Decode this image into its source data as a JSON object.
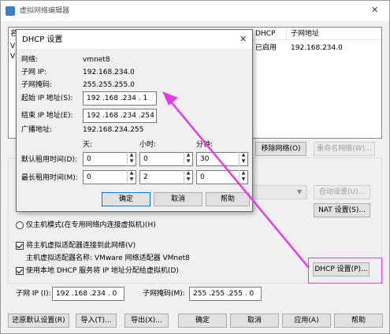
{
  "main_window": {
    "title": "虚拟网络编辑器",
    "close_glyph": "✕",
    "table": {
      "headers": [
        "名",
        "DHCP",
        "子网地址"
      ],
      "rows": [
        {
          "name": "V",
          "dhcp": "",
          "subnet": ""
        },
        {
          "name": "V",
          "dhcp": "已启用",
          "subnet": "192.168.234.0"
        }
      ]
    },
    "buttons": {
      "remove_network": "移除网络(O)",
      "rename_network": "重命名网络(W)...",
      "auto_settings": "自动设置(U)...",
      "nat_settings": "NAT 设置(S)...",
      "dhcp_settings": "DHCP 设置(P)...",
      "restore_defaults": "还原默认设置(R)",
      "import": "导入(T)...",
      "export": "导出(X)...",
      "ok": "确定",
      "cancel": "取消",
      "apply": "应用(A)",
      "help": "帮助"
    },
    "host_only_label": "仅主机模式(在专用网络内连接虚拟机)(H)",
    "connect_adapter_label": "将主机虚拟适配器连接到此网络(V)",
    "adapter_name_label": "主机虚拟适配器名称: VMware 网络适配器 VMnet8",
    "use_dhcp_label": "使用本地 DHCP 服务将 IP 地址分配给虚拟机(D)",
    "subnet_ip_label": "子网 IP (I):",
    "subnet_ip_value": "192 .168 .234 . 0",
    "subnet_mask_label": "子网掩码(M):",
    "subnet_mask_value": "255 .255 .255 . 0"
  },
  "dhcp_dialog": {
    "title": "DHCP 设置",
    "close_glyph": "✕",
    "network_label": "网络:",
    "network_value": "vmnet8",
    "subnet_ip_label": "子网 IP:",
    "subnet_ip_value": "192.168.234.0",
    "subnet_mask_label": "子网掩码:",
    "subnet_mask_value": "255.255.255.0",
    "start_ip_label": "起始 IP 地址(S):",
    "start_ip_value": "192 .168 .234 . 1",
    "end_ip_label": "结束 IP 地址(E):",
    "end_ip_value": "192 .168 .234 .254",
    "broadcast_label": "广播地址:",
    "broadcast_value": "192.168.234.255",
    "col_days": "天:",
    "col_hours": "小时:",
    "col_minutes": "分钟:",
    "default_lease_label": "默认租用时间(D):",
    "default_lease": {
      "days": "0",
      "hours": "0",
      "minutes": "30"
    },
    "max_lease_label": "最长租用时间(M):",
    "max_lease": {
      "days": "0",
      "hours": "2",
      "minutes": "0"
    },
    "ok": "确定",
    "cancel": "取消",
    "help": "帮助"
  },
  "colors": {
    "annotation": "#e63ce6",
    "focus": "#0078d7"
  }
}
